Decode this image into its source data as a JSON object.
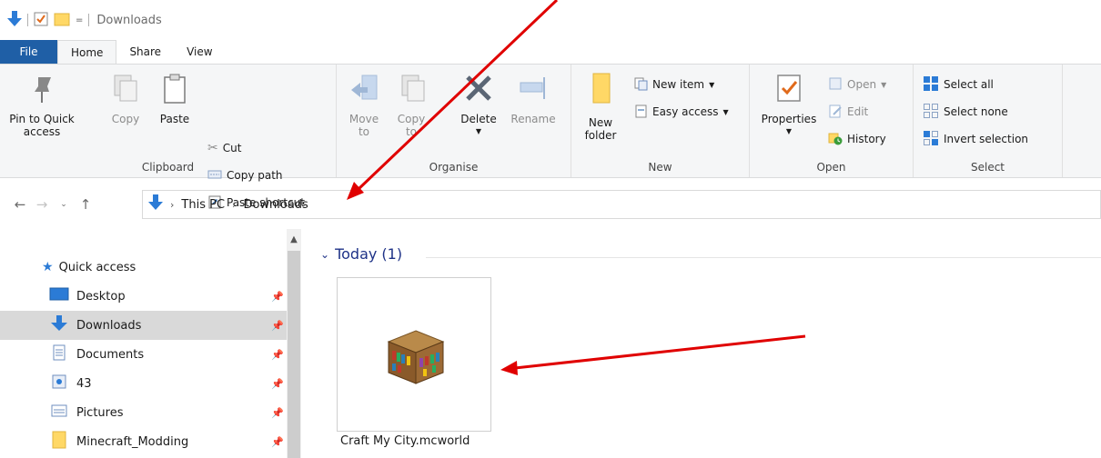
{
  "window": {
    "title": "Downloads"
  },
  "tabs": [
    {
      "label": "File"
    },
    {
      "label": "Home"
    },
    {
      "label": "Share"
    },
    {
      "label": "View"
    }
  ],
  "ribbon": {
    "clipboard": {
      "label": "Clipboard",
      "pin_line1": "Pin to Quick",
      "pin_line2": "access",
      "copy": "Copy",
      "paste": "Paste",
      "cut": "Cut",
      "copy_path": "Copy path",
      "paste_shortcut": "Paste shortcut"
    },
    "organise": {
      "label": "Organise",
      "move_line1": "Move",
      "move_line2": "to",
      "copy_line1": "Copy",
      "copy_line2": "to",
      "delete": "Delete",
      "rename": "Rename"
    },
    "new": {
      "label": "New",
      "folder_line1": "New",
      "folder_line2": "folder",
      "new_item": "New item",
      "easy_access": "Easy access"
    },
    "open": {
      "label": "Open",
      "properties": "Properties",
      "open": "Open",
      "edit": "Edit",
      "history": "History"
    },
    "select": {
      "label": "Select",
      "select_all": "Select all",
      "select_none": "Select none",
      "invert": "Invert selection"
    }
  },
  "address": {
    "crumbs": [
      "This PC",
      "Downloads"
    ]
  },
  "navpane": {
    "items": [
      {
        "label": "Quick access",
        "icon": "star-icon"
      },
      {
        "label": "Desktop",
        "icon": "desktop-icon",
        "pinned": true
      },
      {
        "label": "Downloads",
        "icon": "download-arrow-icon",
        "pinned": true,
        "selected": true
      },
      {
        "label": "Documents",
        "icon": "document-icon",
        "pinned": true
      },
      {
        "label": "43",
        "icon": "recycle-icon",
        "pinned": true
      },
      {
        "label": "Pictures",
        "icon": "pictures-icon",
        "pinned": true
      },
      {
        "label": "Minecraft_Modding",
        "icon": "folder-icon",
        "pinned": true
      }
    ]
  },
  "content": {
    "group_header": "Today (1)",
    "file_name": "Craft My City.mcworld"
  },
  "colors": {
    "accent": "#1f5fa6",
    "group_header": "#1e3287",
    "annotation_arrow": "#e00000"
  }
}
